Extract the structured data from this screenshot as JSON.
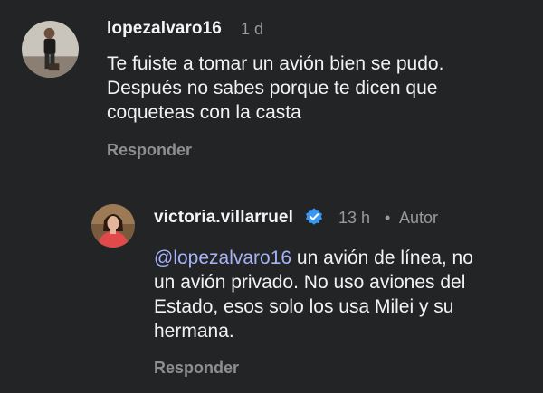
{
  "comments": [
    {
      "username": "lopezalvaro16",
      "time": "1 d",
      "lines": [
        "Te fuiste a tomar un avión bien se pudo.",
        "Después no sabes porque te dicen que",
        "coqueteas con la casta"
      ],
      "reply_label": "Responder"
    }
  ],
  "reply": {
    "username": "victoria.villarruel",
    "verified": true,
    "time": "13 h",
    "separator": "•",
    "badge": "Autor",
    "mention": "@lopezalvaro16",
    "first_line_rest": " un avión de línea, no",
    "lines": [
      "un avión privado. No uso aviones del",
      "Estado, esos solo los usa Milei y su",
      "hermana."
    ],
    "reply_label": "Responder"
  },
  "colors": {
    "background": "#232426",
    "mention": "#a7b3f7",
    "verified": "#3897f0",
    "muted": "#9a9a9a"
  },
  "icons": {
    "verified": "verified-badge-icon"
  }
}
